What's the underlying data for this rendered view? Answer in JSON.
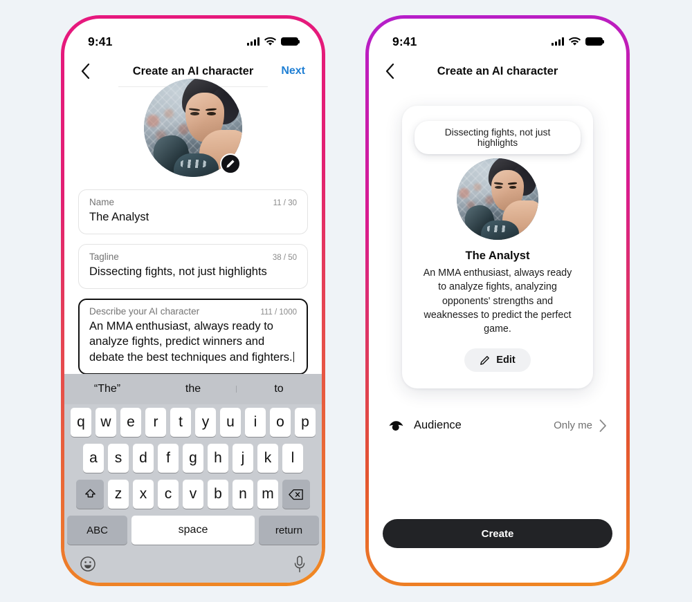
{
  "theme": {
    "page_bg": "#eff3f7",
    "frame_gradient_left": [
      "#e6187e",
      "#f08a22"
    ],
    "frame_gradient_right": [
      "#b51ecb",
      "#f08a22"
    ],
    "next_link_color": "#1f7fd4",
    "create_button_bg": "#222326"
  },
  "left_phone": {
    "status": {
      "time": "9:41",
      "signal_icon": "signal-bars-icon",
      "wifi_icon": "wifi-icon",
      "battery_icon": "battery-full-icon"
    },
    "nav": {
      "back_icon": "chevron-left-icon",
      "title": "Create an AI character",
      "next_label": "Next"
    },
    "avatar": {
      "icon": "avatar-image",
      "edit_badge_icon": "pencil-icon"
    },
    "fields": [
      {
        "label": "Name",
        "counter": "11 / 30",
        "value": "The Analyst",
        "focused": false
      },
      {
        "label": "Tagline",
        "counter": "38 / 50",
        "value": "Dissecting fights, not just highlights",
        "focused": false
      },
      {
        "label": "Describe your AI character",
        "counter": "111 / 1000",
        "value": "An MMA enthusiast, always ready to analyze fights, predict winners and debate the best techniques and fighters.",
        "focused": true
      }
    ],
    "keyboard": {
      "suggestions": [
        "“The”",
        "the",
        "to"
      ],
      "row1": [
        "q",
        "w",
        "e",
        "r",
        "t",
        "y",
        "u",
        "i",
        "o",
        "p"
      ],
      "row2": [
        "a",
        "s",
        "d",
        "f",
        "g",
        "h",
        "j",
        "k",
        "l"
      ],
      "row3": [
        "z",
        "x",
        "c",
        "v",
        "b",
        "n",
        "m"
      ],
      "shift_icon": "shift-key-icon",
      "backspace_icon": "backspace-key-icon",
      "abc_label": "ABC",
      "space_label": "space",
      "return_label": "return",
      "emoji_icon": "emoji-smiley-icon",
      "mic_icon": "microphone-icon"
    }
  },
  "right_phone": {
    "status": {
      "time": "9:41",
      "signal_icon": "signal-bars-icon",
      "wifi_icon": "wifi-icon",
      "battery_icon": "battery-full-icon"
    },
    "nav": {
      "back_icon": "chevron-left-icon",
      "title": "Create an AI character"
    },
    "preview": {
      "bubble_text": "Dissecting fights, not just highlights",
      "avatar_icon": "avatar-image",
      "name": "The Analyst",
      "description": "An MMA enthusiast, always ready to analyze fights, analyzing opponents' strengths and weaknesses to predict the perfect game.",
      "edit_label": "Edit",
      "edit_icon": "pencil-icon"
    },
    "audience": {
      "icon": "audience-privacy-icon",
      "label": "Audience",
      "value": "Only me",
      "chevron_icon": "chevron-right-icon"
    },
    "create_label": "Create"
  }
}
